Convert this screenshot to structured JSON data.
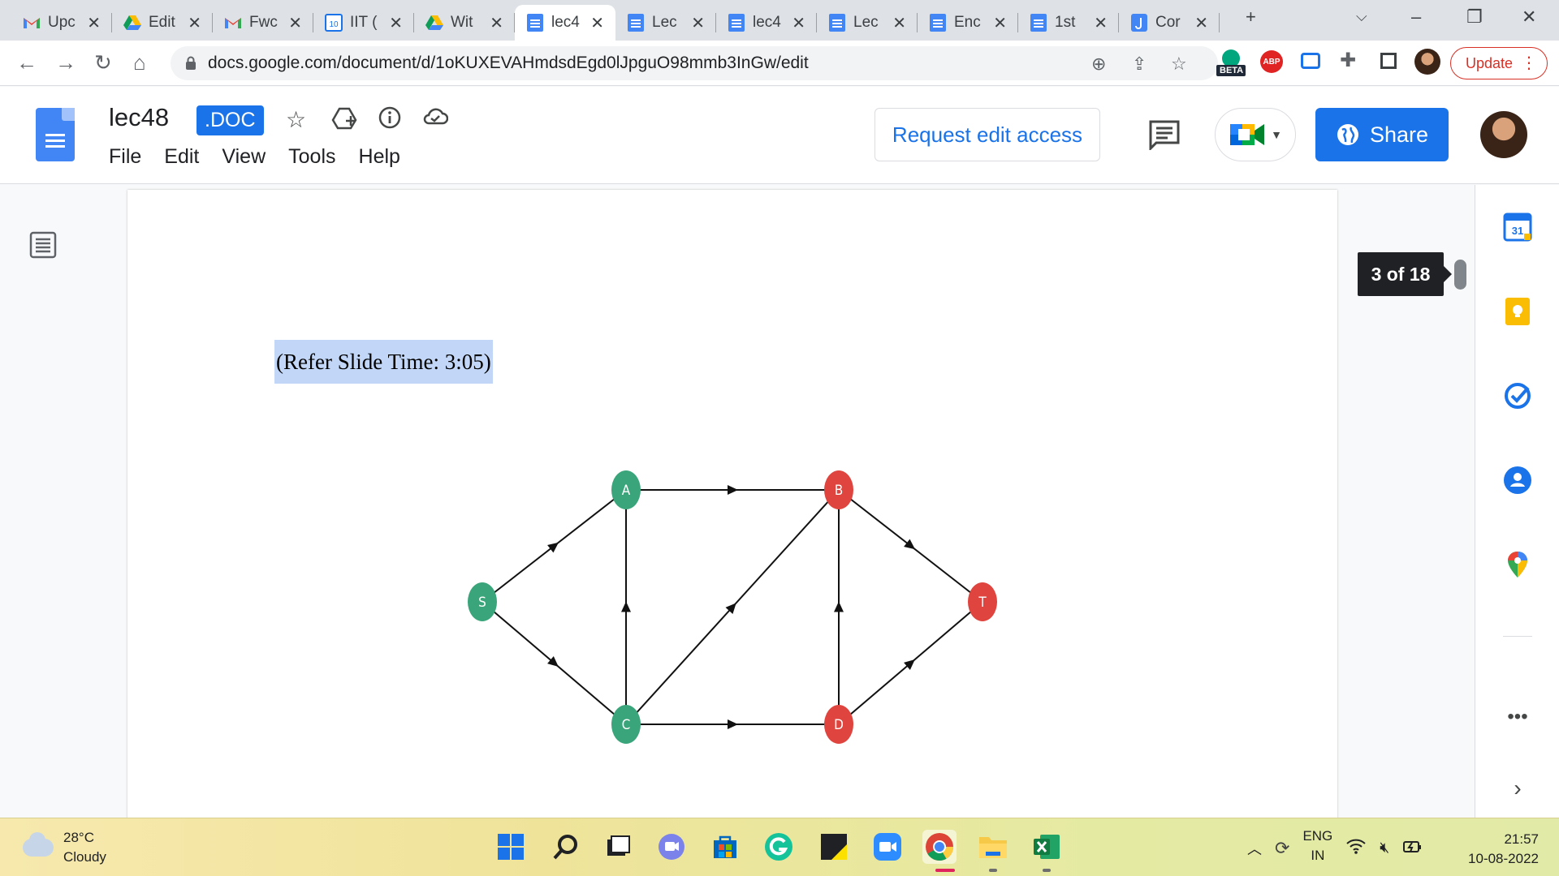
{
  "browser": {
    "tabs": [
      {
        "title": "Upc",
        "icon": "gmail-icon",
        "active": false
      },
      {
        "title": "Edit",
        "icon": "drive-icon",
        "active": false
      },
      {
        "title": "Fwc",
        "icon": "gmail-icon",
        "active": false
      },
      {
        "title": "IIT (",
        "icon": "calendar-icon",
        "active": false
      },
      {
        "title": "Wit",
        "icon": "drive-icon",
        "active": false
      },
      {
        "title": "lec4",
        "icon": "docs-icon",
        "active": true
      },
      {
        "title": "Lec",
        "icon": "docs-icon",
        "active": false
      },
      {
        "title": "lec4",
        "icon": "docs-icon",
        "active": false
      },
      {
        "title": "Lec",
        "icon": "docs-icon",
        "active": false
      },
      {
        "title": "Enc",
        "icon": "docs-icon",
        "active": false
      },
      {
        "title": "1st",
        "icon": "docs-icon",
        "active": false
      },
      {
        "title": "Cor",
        "icon": "app-icon",
        "active": false
      }
    ],
    "new_tab": "+",
    "url": "docs.google.com/document/d/1oKUXEVAHmdsdEgd0lJpguO98mmb3InGw/edit",
    "beta_label": "BETA",
    "abp_label": "ABP",
    "update_label": "Update"
  },
  "docs": {
    "title": "lec48",
    "badge": ".DOC",
    "menu": [
      "File",
      "Edit",
      "View",
      "Tools",
      "Help"
    ],
    "request_edit": "Request edit access",
    "share": "Share"
  },
  "page": {
    "slide_ref": "(Refer Slide Time: 3:05)",
    "page_counter": "3 of 18"
  },
  "graph": {
    "colors": {
      "green": "#3aa57a",
      "red": "#e0443e"
    },
    "nodes": [
      {
        "id": "S",
        "color": "green"
      },
      {
        "id": "A",
        "color": "green"
      },
      {
        "id": "C",
        "color": "green"
      },
      {
        "id": "B",
        "color": "red"
      },
      {
        "id": "D",
        "color": "red"
      },
      {
        "id": "T",
        "color": "red"
      }
    ],
    "edges": [
      {
        "from": "S",
        "to": "A"
      },
      {
        "from": "S",
        "to": "C"
      },
      {
        "from": "C",
        "to": "A"
      },
      {
        "from": "A",
        "to": "B"
      },
      {
        "from": "C",
        "to": "B"
      },
      {
        "from": "C",
        "to": "D"
      },
      {
        "from": "D",
        "to": "B"
      },
      {
        "from": "B",
        "to": "T"
      },
      {
        "from": "D",
        "to": "T"
      }
    ]
  },
  "taskbar": {
    "temperature": "28°C",
    "weather": "Cloudy",
    "language": "ENG",
    "region": "IN",
    "time": "21:57",
    "date": "10-08-2022"
  },
  "colors": {
    "accent": "#1a73e8",
    "selection": "#c2d7f7"
  }
}
